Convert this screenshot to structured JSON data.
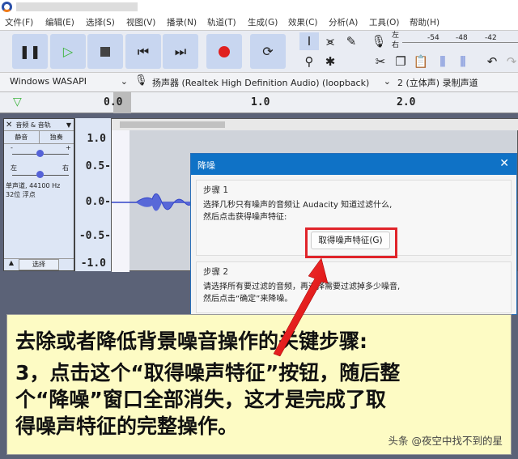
{
  "menu": [
    "文件(F)",
    "编辑(E)",
    "选择(S)",
    "视图(V)",
    "播录(N)",
    "轨道(T)",
    "生成(G)",
    "效果(C)",
    "分析(A)",
    "工具(O)",
    "帮助(H)"
  ],
  "meter": {
    "left": "左",
    "right": "右",
    "ticks": [
      "-54",
      "-48",
      "-42"
    ]
  },
  "devices": {
    "host": "Windows WASAPI",
    "input": "扬声器 (Realtek High Definition Audio) (loopback)",
    "channels": "2 (立体声) 录制声道"
  },
  "ruler": [
    "0.0",
    "1.0",
    "2.0"
  ],
  "track": {
    "name": "音频 & 音轨",
    "mute": "静音",
    "solo": "独奏",
    "left": "左",
    "right": "右",
    "info1": "单声道, 44100 Hz",
    "info2": "32位 浮点",
    "select": "选择",
    "minus": "-",
    "plus": "+"
  },
  "scale": [
    "1.0",
    "0.5-",
    "0.0-",
    "-0.5-",
    "-1.0"
  ],
  "dialog": {
    "title": "降噪",
    "close": "✕",
    "step1": "步骤 1",
    "step1_text1": "选择几秒只有噪声的音频让 Audacity 知道过滤什么,",
    "step1_text2": "然后点击获得噪声特征:",
    "button": "取得噪声特征(G)",
    "step2": "步骤 2",
    "step2_text1": "请选择所有要过滤的音频，再选择需要过滤掉多少噪音,",
    "step2_text2": "然后点击“确定”来降噪。"
  },
  "caption": {
    "line1": "去除或者降低背景噪音操作的关键步骤:",
    "line2": "3，点击这个“取得噪声特征”按钮，随后整",
    "line3": "个“降噪”窗口全部消失，这才是完成了取",
    "line4": "得噪声特征的完整操作。",
    "watermark": "头条 @夜空中找不到的星"
  },
  "colors": {
    "accent": "#0f72c6",
    "highlight": "#e0242a",
    "caption_bg": "#fdfbc4"
  }
}
